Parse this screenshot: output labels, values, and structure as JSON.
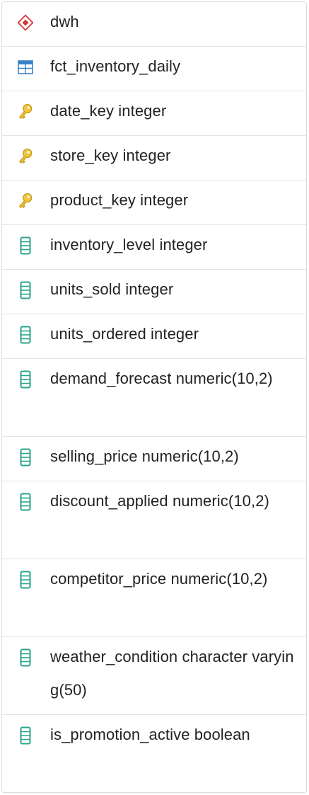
{
  "tree": {
    "schema": {
      "icon": "schema-icon",
      "label": "dwh"
    },
    "table": {
      "icon": "table-icon",
      "label": "fct_inventory_daily"
    },
    "columns": [
      {
        "icon": "key-icon",
        "label": "date_key integer"
      },
      {
        "icon": "key-icon",
        "label": "store_key integer"
      },
      {
        "icon": "key-icon",
        "label": "product_key integer"
      },
      {
        "icon": "column-icon",
        "label": "inventory_level integer"
      },
      {
        "icon": "column-icon",
        "label": "units_sold integer"
      },
      {
        "icon": "column-icon",
        "label": "units_ordered integer"
      },
      {
        "icon": "column-icon",
        "label": "demand_forecast numeric(10,2)"
      },
      {
        "icon": "column-icon",
        "label": "selling_price numeric(10,2)"
      },
      {
        "icon": "column-icon",
        "label": "discount_applied numeric(10,2)"
      },
      {
        "icon": "column-icon",
        "label": "competitor_price numeric(10,2)"
      },
      {
        "icon": "column-icon",
        "label": "weather_condition character varying(50)"
      },
      {
        "icon": "column-icon",
        "label": "is_promotion_active boolean"
      }
    ]
  },
  "colors": {
    "schema_icon": "#d23a3a",
    "table_icon": "#3b82c8",
    "key_icon": "#e2b320",
    "column_icon": "#2aa58c",
    "row_border": "#dfe3e8"
  }
}
